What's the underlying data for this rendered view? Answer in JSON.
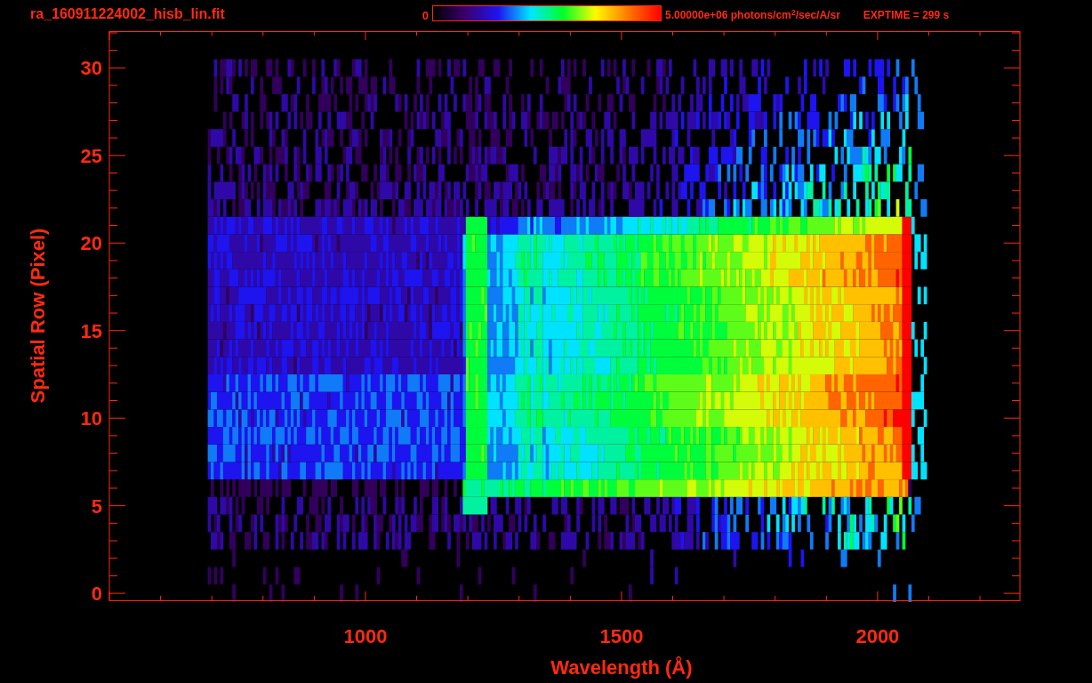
{
  "title": "ra_160911224002_hisb_lin.fit",
  "colorbar": {
    "min_label": "0",
    "max_label": "5.00000e+06 photons/cm$^{2}$/sec/A/sr"
  },
  "exposure": "EXPTIME = 299 s",
  "plot": {
    "y_axis": {
      "label": "Spatial Row (Pixel)",
      "ticks": [
        "30",
        "25",
        "20",
        "15",
        "10",
        "5",
        "0"
      ]
    },
    "x_axis": {
      "label": "Wavelength (Å)",
      "ticks": [
        "1000",
        "1500",
        "2000"
      ]
    }
  }
}
